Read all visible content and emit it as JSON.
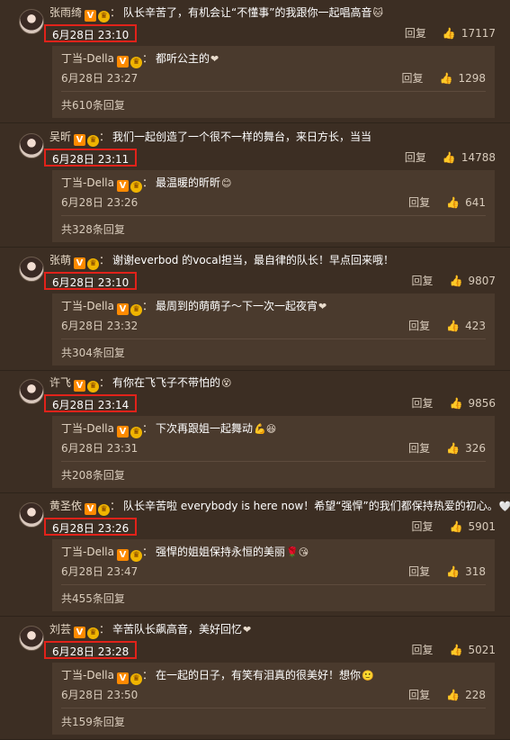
{
  "reply_label": "回复",
  "comments": [
    {
      "user": "张雨绮",
      "text": "队长辛苦了，有机会让“不懂事”的我跟你一起唱高音",
      "time": "6月28日 23:10",
      "likes": "17117",
      "reply": {
        "user": "丁当-Della",
        "text": "都听公主的",
        "time": "6月28日 23:27",
        "likes": "1298"
      },
      "total": "共610条回复"
    },
    {
      "user": "吴昕",
      "text": "我们一起创造了一个很不一样的舞台，来日方长，当当",
      "time": "6月28日 23:11",
      "likes": "14788",
      "reply": {
        "user": "丁当-Della",
        "text": "最温暖的昕昕",
        "time": "6月28日 23:26",
        "likes": "641"
      },
      "total": "共328条回复"
    },
    {
      "user": "张萌",
      "text": "谢谢everbod 的vocal担当，最自律的队长！早点回来哦！",
      "time": "6月28日 23:10",
      "likes": "9807",
      "reply": {
        "user": "丁当-Della",
        "text": "最周到的萌萌子～下一次一起夜宵",
        "time": "6月28日 23:32",
        "likes": "423"
      },
      "total": "共304条回复"
    },
    {
      "user": "许飞",
      "text": "有你在飞飞子不带怕的",
      "time": "6月28日 23:14",
      "likes": "9856",
      "reply": {
        "user": "丁当-Della",
        "text": "下次再跟姐一起舞动",
        "time": "6月28日 23:31",
        "likes": "326"
      },
      "total": "共208条回复"
    },
    {
      "user": "黄圣依",
      "text": "队长辛苦啦 everybody is here now！希望“强悍”的我们都保持热爱的初心。",
      "time": "6月28日 23:26",
      "likes": "5901",
      "reply": {
        "user": "丁当-Della",
        "text": "强悍的姐姐保持永恒的美丽",
        "time": "6月28日 23:47",
        "likes": "318"
      },
      "total": "共455条回复"
    },
    {
      "user": "刘芸",
      "text": "辛苦队长飙高音，美好回忆",
      "time": "6月28日 23:28",
      "likes": "5021",
      "reply": {
        "user": "丁当-Della",
        "text": "在一起的日子，有笑有泪真的很美好！想你",
        "time": "6月28日 23:50",
        "likes": "228"
      },
      "total": "共159条回复"
    }
  ]
}
